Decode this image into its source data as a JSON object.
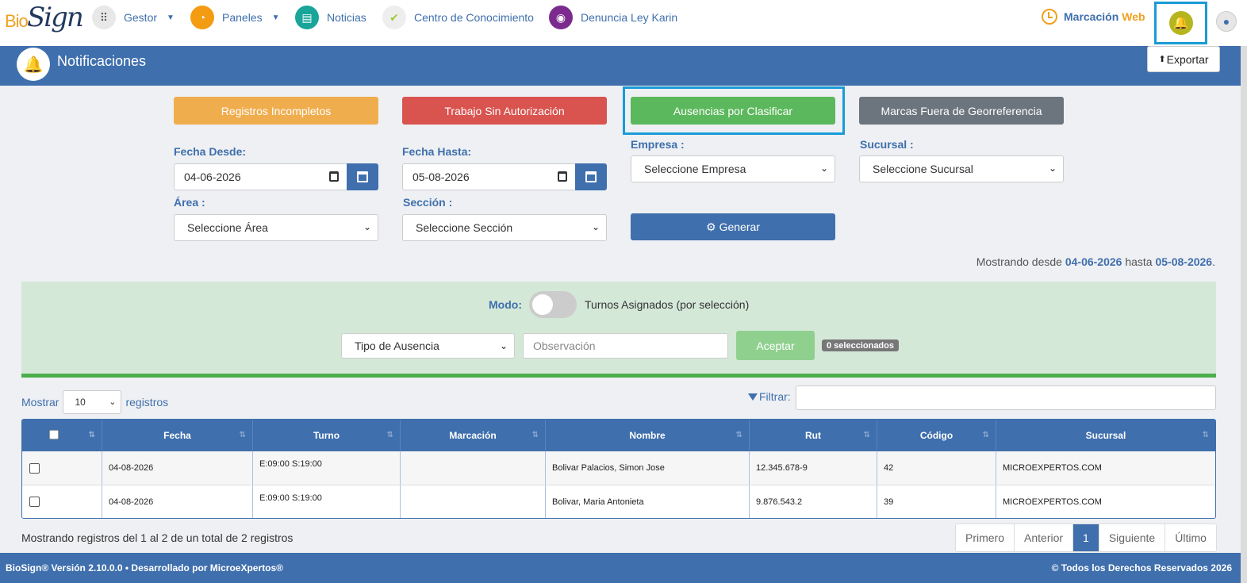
{
  "brand": {
    "bio": "Bio",
    "sign": "Sign"
  },
  "nav": {
    "gestor": "Gestor",
    "paneles": "Paneles",
    "noticias": "Noticias",
    "centro": "Centro de Conocimiento",
    "denuncia": "Denuncia Ley Karin",
    "marcacion": "Marcación",
    "marcacion_web": "Web"
  },
  "page": {
    "title": "Notificaciones",
    "export_label": "Exportar"
  },
  "categories": {
    "incompletos": "Registros Incompletos",
    "sin_autorizacion": "Trabajo Sin Autorización",
    "ausencias": "Ausencias por Clasificar",
    "georef": "Marcas Fuera de Georreferencia"
  },
  "form": {
    "fecha_desde_label": "Fecha Desde:",
    "fecha_desde": "04-06-2026",
    "fecha_hasta_label": "Fecha Hasta:",
    "fecha_hasta": "05-08-2026",
    "empresa_label": "Empresa :",
    "empresa_value": "Seleccione Empresa",
    "sucursal_label": "Sucursal :",
    "sucursal_value": "Seleccione Sucursal",
    "area_label": "Área :",
    "area_value": "Seleccione Área",
    "seccion_label": "Sección :",
    "seccion_value": "Seleccione Sección",
    "generar": "Generar"
  },
  "range": {
    "prefix": "Mostrando desde",
    "from": "04-06-2026",
    "mid": "hasta",
    "to": "05-08-2026",
    "suffix": "."
  },
  "mode": {
    "label": "Modo:",
    "toggle_text": "Turnos Asignados (por selección)",
    "tipo_value": "Tipo de Ausencia",
    "observacion_placeholder": "Observación",
    "aceptar": "Aceptar",
    "selected_badge": "0 seleccionados"
  },
  "table_controls": {
    "mostrar": "Mostrar",
    "page_size": "10",
    "registros": "registros",
    "filtrar": "Filtrar:"
  },
  "table": {
    "headers": {
      "fecha": "Fecha",
      "turno": "Turno",
      "marcacion": "Marcación",
      "nombre": "Nombre",
      "rut": "Rut",
      "codigo": "Código",
      "sucursal": "Sucursal"
    },
    "rows": [
      {
        "fecha": "04-08-2026",
        "turno": "E:09:00 S:19:00",
        "marcacion": "",
        "nombre": "Bolivar Palacios, Simon Jose",
        "rut": "12.345.678-9",
        "codigo": "42",
        "sucursal": "MICROEXPERTOS.COM"
      },
      {
        "fecha": "04-08-2026",
        "turno": "E:09:00 S:19:00",
        "marcacion": "",
        "nombre": "Bolivar, Maria Antonieta",
        "rut": "9.876.543.2",
        "codigo": "39",
        "sucursal": "MICROEXPERTOS.COM"
      }
    ]
  },
  "summary": "Mostrando registros del 1 al 2 de un total de 2 registros",
  "pagination": {
    "first": "Primero",
    "prev": "Anterior",
    "current": "1",
    "next": "Siguiente",
    "last": "Último"
  },
  "footer": {
    "left": "BioSign® Versión 2.10.0.0 • Desarrollado por MicroeXpertos®",
    "right": "© Todos los Derechos Reservados 2026"
  },
  "colors": {
    "primary": "#3f6fad",
    "orange": "#f0ad4e",
    "red": "#d9534f",
    "green": "#5cb85c",
    "gray": "#6c757d",
    "highlight": "#1a9bd7"
  }
}
